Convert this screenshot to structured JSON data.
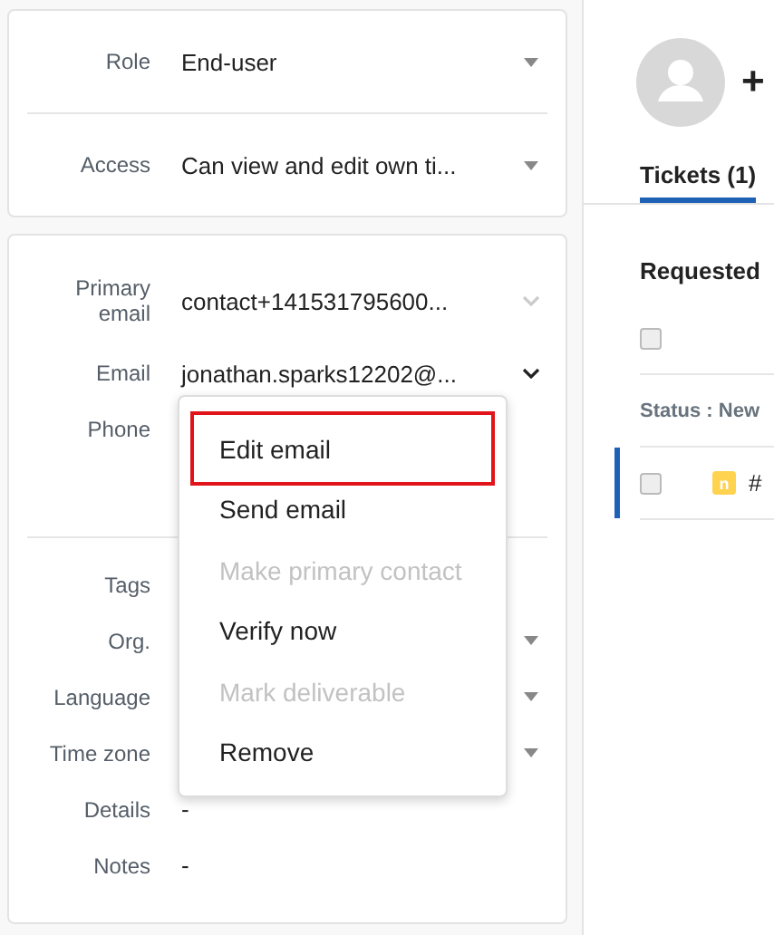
{
  "access_card": {
    "fields": [
      {
        "label": "Role",
        "value": "End-user",
        "kind": "dropdown"
      },
      {
        "label": "Access",
        "value": "Can view and edit own ti...",
        "kind": "dropdown"
      }
    ]
  },
  "contact_card": {
    "fields": [
      {
        "label": "Primary email",
        "value": "contact+141531795600...",
        "kind": "chevron",
        "expanded": false
      },
      {
        "label": "Email",
        "value": "jonathan.sparks12202@...",
        "kind": "chevron",
        "expanded": true
      },
      {
        "label": "Phone",
        "kind": "text"
      }
    ],
    "details": [
      {
        "label": "Tags",
        "kind": "text"
      },
      {
        "label": "Org.",
        "kind": "dropdown"
      },
      {
        "label": "Language",
        "kind": "dropdown"
      },
      {
        "label": "Time zone",
        "kind": "dropdown"
      },
      {
        "label": "Details",
        "value": "-",
        "kind": "text"
      },
      {
        "label": "Notes",
        "value": "-",
        "kind": "text"
      }
    ]
  },
  "email_menu": {
    "items": [
      {
        "label": "Edit email",
        "disabled": false,
        "highlighted": true
      },
      {
        "label": "Send email",
        "disabled": false,
        "highlighted": false
      },
      {
        "label": "Make primary contact",
        "disabled": true,
        "highlighted": false
      },
      {
        "label": "Verify now",
        "disabled": false,
        "highlighted": false
      },
      {
        "label": "Mark deliverable",
        "disabled": true,
        "highlighted": false
      },
      {
        "label": "Remove",
        "disabled": false,
        "highlighted": false
      }
    ]
  },
  "profile": {
    "name": "+",
    "tabs": [
      {
        "label": "Tickets (1)",
        "selected": true
      }
    ],
    "section": "Requested",
    "select_all": {
      "checked": false
    },
    "group": "Status : New",
    "rows": [
      {
        "badge": "n",
        "id": "#",
        "selected": true,
        "checked": false
      }
    ]
  }
}
